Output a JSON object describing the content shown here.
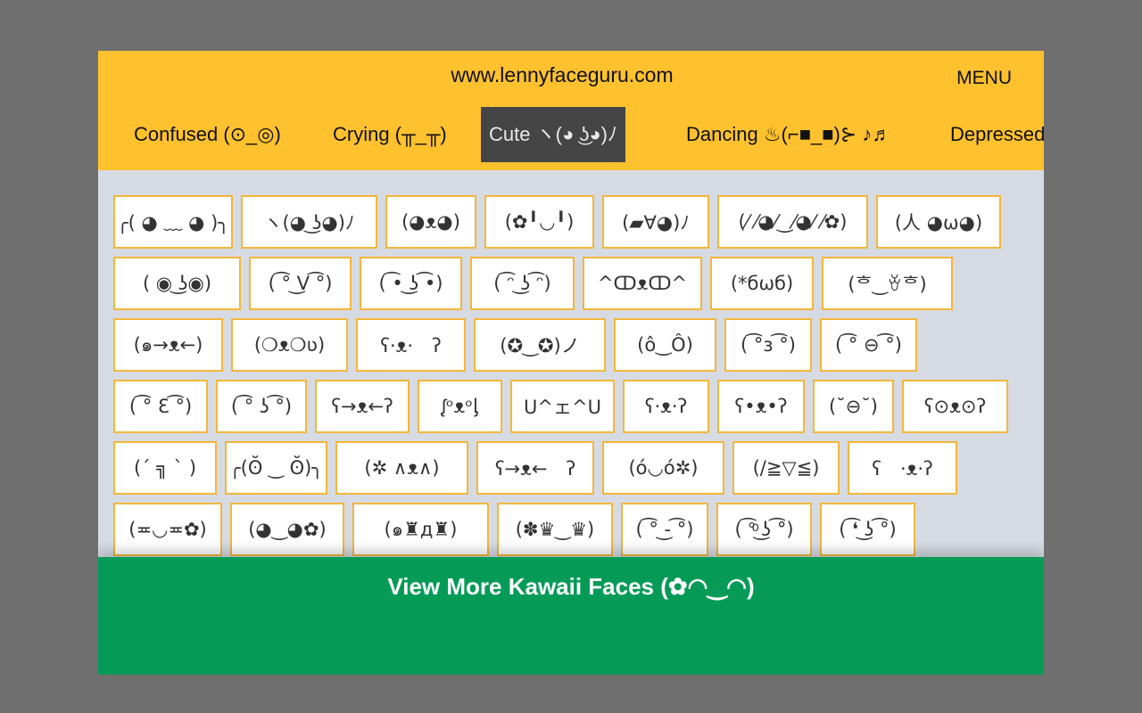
{
  "header": {
    "site_url": "www.lennyfaceguru.com",
    "menu_label": "MENU"
  },
  "tabs": [
    {
      "label": "Confused (⊙_◎)",
      "active": false
    },
    {
      "label": "Crying (╥_╥)",
      "active": false
    },
    {
      "label": "Cute ヽ(◕ ͜ʖ◕)ﾉ",
      "active": true
    },
    {
      "label": "Dancing ♨(⌐■_■)⊱ ♪♬",
      "active": false
    },
    {
      "label": "Depressed",
      "active": false
    }
  ],
  "faces": [
    [
      "╭( ◕ ﹏ ◕ )╮",
      "ヽ(◕ ͜ʖ◕)ﾉ",
      "(◕ᴥ◕)",
      "(✿╹◡╹)",
      "(▰∀◕)ﾉ",
      "(⁄ ⁄◕⁄‿⁄◕⁄ ⁄✿)",
      "(人 ◕ω◕)"
    ],
    [
      "( ◉ ͜ʖ◉)",
      "( ͡° ͜V ͡°)",
      "( ͡• ͜ʖ ͡•)",
      "( ͡ᵔ ͜ʖ ͡ᵔ)",
      "^ↀᴥↀ^",
      "(*бωб)",
      "(ᄒ‿ꈊᄒ)"
    ],
    [
      "(๑→ᴥ←)",
      "(❍ᴥ❍ʋ)",
      "ʕ·ᴥ·　ʔ",
      "(✪‿✪)ノ",
      "(ô‿Ô)",
      "( ͡°з ͡°)",
      "( ͡° ⊖ ͡°)"
    ],
    [
      "( ͡° Ɛ ͡°)",
      "( ͡° ʖ ͡°)",
      "ʕ→ᴥ←ʔ",
      "ᶘᵒᴥᵒᶅ",
      "U^ェ^U",
      "ʕ·ᴥ·ʔ",
      "ʕ•ᴥ•ʔ",
      "(˘⊖˘)",
      "ʕ⊙ᴥ⊙ʔ"
    ],
    [
      "(´ ╗ ` )",
      "╭(ʘ̆ ‿ ʘ̆)╮",
      "(✲ ∧ᴥ∧)",
      "ʕ→ᴥ←　ʔ",
      "(ó◡ó✲)",
      "(/≧▽≦)",
      "ʕ　·ᴥ·ʔ"
    ],
    [
      "(≖◡≖✿)",
      "(◕‿◕✿)",
      "(๑♜д♜)",
      "(✽♛‿♛)",
      "( ͡° ͜- ͡°)",
      "( ͡°ͦ ͜ʖ ͡°)",
      "( ͡❛ ͜ʖ ͡°)"
    ]
  ],
  "cta": {
    "label": "View More Kawaii Faces (✿◠‿◠)"
  }
}
